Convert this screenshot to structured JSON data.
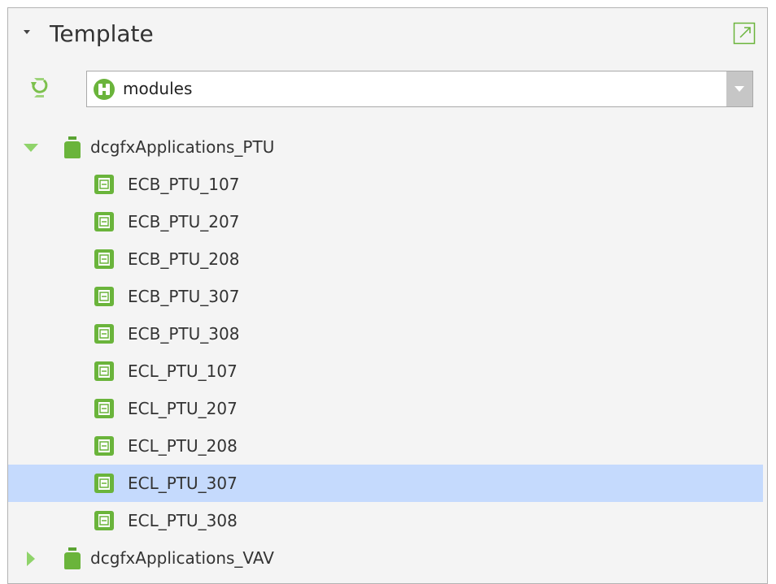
{
  "panel": {
    "title": "Template",
    "selector": {
      "value": "modules",
      "icon": "module-icon"
    }
  },
  "tree": {
    "groups": [
      {
        "label": "dcgfxApplications_PTU",
        "expanded": true,
        "icon": "application-jar-icon",
        "children": [
          {
            "label": "ECB_PTU_107",
            "selected": false
          },
          {
            "label": "ECB_PTU_207",
            "selected": false
          },
          {
            "label": "ECB_PTU_208",
            "selected": false
          },
          {
            "label": "ECB_PTU_307",
            "selected": false
          },
          {
            "label": "ECB_PTU_308",
            "selected": false
          },
          {
            "label": "ECL_PTU_107",
            "selected": false
          },
          {
            "label": "ECL_PTU_207",
            "selected": false
          },
          {
            "label": "ECL_PTU_208",
            "selected": false
          },
          {
            "label": "ECL_PTU_307",
            "selected": true
          },
          {
            "label": "ECL_PTU_308",
            "selected": false
          }
        ]
      },
      {
        "label": "dcgfxApplications_VAV",
        "expanded": false,
        "icon": "application-jar-icon",
        "children": []
      }
    ]
  },
  "colors": {
    "accent_green": "#6ab43b",
    "selection": "#c5dafd",
    "panel_bg": "#f4f4f4",
    "border": "#b3b3b3"
  }
}
